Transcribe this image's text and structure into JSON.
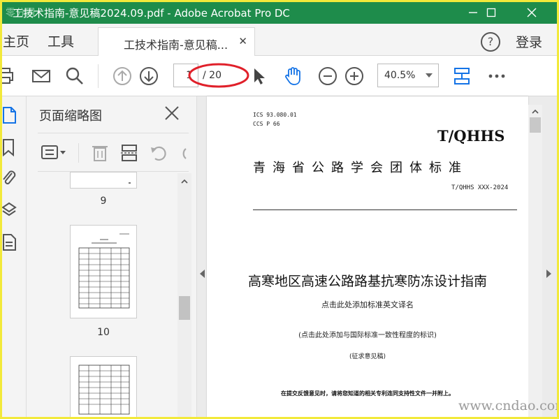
{
  "window": {
    "title": "工技术指南-意见稿2024.09.pdf - Adobe Acrobat Pro DC",
    "watermark": "零分网"
  },
  "tabs": {
    "home": "主页",
    "tools": "工具",
    "doc": "工技术指南-意见稿...",
    "login": "登录"
  },
  "toolbar": {
    "current_page": "1",
    "total_pages": "/ 20",
    "zoom": "40.5%"
  },
  "thumbnail_panel": {
    "title": "页面缩略图",
    "thumbs": [
      {
        "label": "9"
      },
      {
        "label": "10"
      },
      {
        "label": ""
      }
    ]
  },
  "document": {
    "ics": "ICS 93.080.01",
    "ccs": "CCS P 66",
    "logo": "T/QHHS",
    "org": "青海省公路学会团体标准",
    "code": "T/QHHS XXX-2024",
    "title": "高寒地区高速公路路基抗寒防冻设计指南",
    "english_placeholder": "点击此处添加标准英文译名",
    "intl_placeholder": "(点击此处添加与国际标准一致性程度的标识)",
    "draft": "(征求意见稿)",
    "note": "在提交反馈意见时，请将您知道的相关专利连同支持性文件一并附上。"
  },
  "site_watermark": "www.cndao.com",
  "colors": {
    "titlebar": "#1e8c4b",
    "accent_blue": "#1473e6",
    "annotation_red": "#e0202a",
    "frame_yellow": "#f2e93a"
  }
}
